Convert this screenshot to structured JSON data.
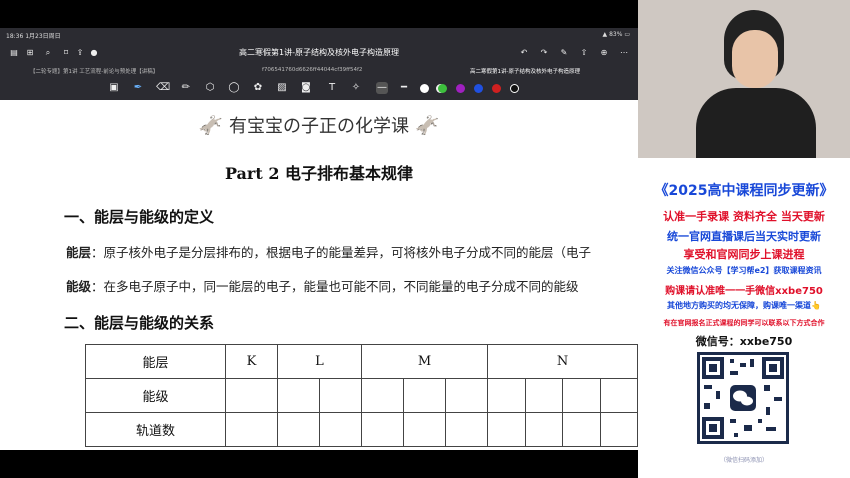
{
  "status": {
    "time_date": "18:36  1月23日周日",
    "battery": "83%"
  },
  "window_title": "高二寒假第1讲-原子结构及核外电子构造原理",
  "tabs": [
    "【二轮专题】第1讲 工艺流程-前论与预处理【讲稿】",
    "f706541760d6626ff44044cf39ff54f2",
    "高二寒假第1讲-原子结构及核外电子构造原理"
  ],
  "toolbar_colors": [
    "#ffffff",
    "#f0f0f0",
    "#3dbf3d",
    "#a020c0",
    "#2050e0",
    "#d02020",
    "#111111"
  ],
  "doc": {
    "banner": "有宝宝の子正の化学课",
    "part_title": "Part 2  电子排布基本规律",
    "section1": "一、能层与能级的定义",
    "p1_label": "能层",
    "p1_text": "：原子核外电子是分层排布的，根据电子的能量差异，可将核外电子分成不同的能层（电子",
    "p2_label": "能级",
    "p2_text": "：在多电子原子中，同一能层的电子，能量也可能不同，不同能量的电子分成不同的能级",
    "section2": "二、能层与能级的关系",
    "table": {
      "row_labels": [
        "能层",
        "能级",
        "轨道数"
      ],
      "shells": [
        "K",
        "L",
        "M",
        "N"
      ]
    }
  },
  "side": {
    "headline": "《2025高中课程同步更新》",
    "line1": "认准一手录课 资料齐全 当天更新",
    "line2": "统一官网直播课后当天实时更新",
    "line3": "享受和官网同步上课进程",
    "line4": "关注微信公众号【学习帮e2】获取课程资讯",
    "line5": "购课请认准唯一一手微信xxbe750",
    "line6": "其他地方购买的均无保障，购课唯一渠道👆",
    "line7": "有在官网报名正式课程的同学可以联系以下方式合作",
    "wechat": "微信号：xxbe750",
    "qr_caption": "（微信扫码添加）"
  },
  "colors": {
    "red": "#e0102a",
    "blue": "#1848d8",
    "navy": "#1b2a4a",
    "toolbar": "#2b2b31"
  }
}
